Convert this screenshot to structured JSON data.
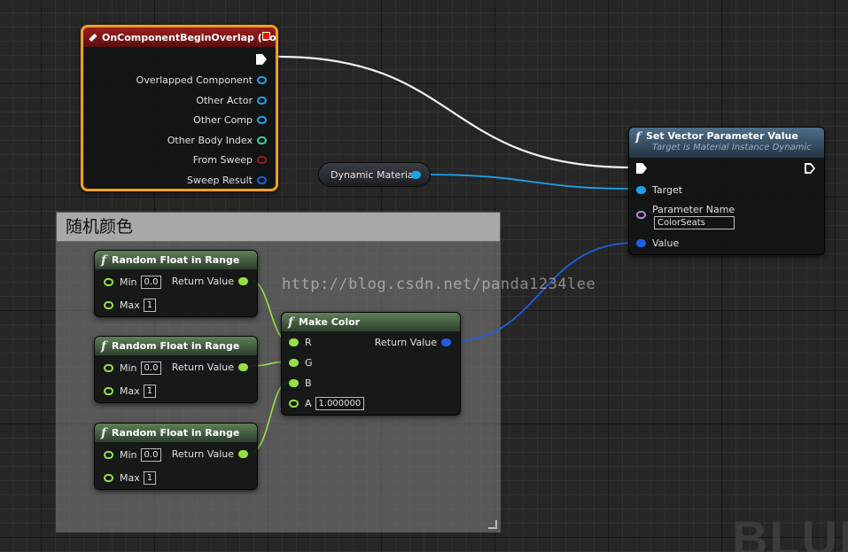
{
  "comment": {
    "title": "随机颜色"
  },
  "event_node": {
    "title": "OnComponentBeginOverlap (Box)",
    "pins": [
      "Overlapped Component",
      "Other Actor",
      "Other Comp",
      "Other Body Index",
      "From Sweep",
      "Sweep Result"
    ],
    "pin_colors": [
      "#1da1e6",
      "#1da1e6",
      "#1da1e6",
      "#2dd6a0",
      "#9a1b1b",
      "#1d5fe6"
    ]
  },
  "dyn_material": {
    "label": "Dynamic Material",
    "pin_color": "#1da1e6"
  },
  "set_vector": {
    "title": "Set Vector Parameter Value",
    "subtitle": "Target is Material Instance Dynamic",
    "target_label": "Target",
    "param_name_label": "Parameter Name",
    "param_name_value": "ColorSeats",
    "value_label": "Value",
    "target_color": "#1da1e6",
    "param_color": "#b489d8",
    "value_color": "#1d5fe6"
  },
  "random_nodes": [
    {
      "title": "Random Float in Range",
      "min_label": "Min",
      "min_value": "0.0",
      "max_label": "Max",
      "max_value": "1",
      "return_label": "Return Value"
    },
    {
      "title": "Random Float in Range",
      "min_label": "Min",
      "min_value": "0.0",
      "max_label": "Max",
      "max_value": "1",
      "return_label": "Return Value"
    },
    {
      "title": "Random Float in Range",
      "min_label": "Min",
      "min_value": "0.0",
      "max_label": "Max",
      "max_value": "1",
      "return_label": "Return Value"
    }
  ],
  "make_color": {
    "title": "Make Color",
    "r_label": "R",
    "g_label": "G",
    "b_label": "B",
    "a_label": "A",
    "a_value": "1.000000",
    "return_label": "Return Value",
    "float_color": "#96e046",
    "return_color": "#1d5fe6"
  },
  "watermark": "http://blog.csdn.net/panda1234lee",
  "corner_logo": "BLUE"
}
